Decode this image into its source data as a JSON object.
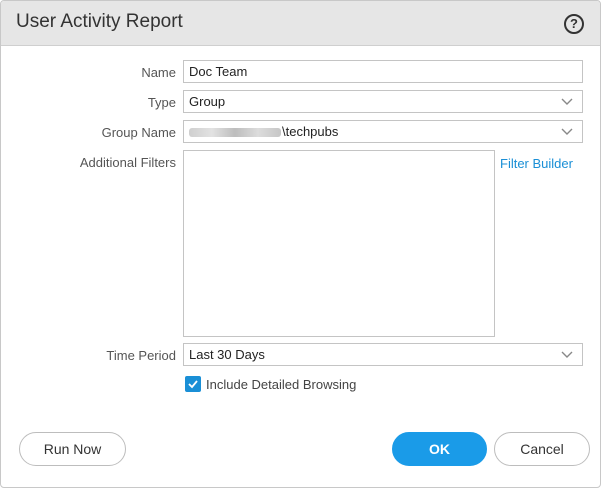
{
  "dialog": {
    "title": "User Activity Report",
    "help_icon": "help-circle-icon"
  },
  "form": {
    "name": {
      "label": "Name",
      "value": "Doc Team"
    },
    "type": {
      "label": "Type",
      "value": "Group"
    },
    "group_name": {
      "label": "Group Name",
      "value": "\\techpubs",
      "prefix_redacted": true
    },
    "additional_filters": {
      "label": "Additional Filters",
      "value": "",
      "link": "Filter Builder"
    },
    "time_period": {
      "label": "Time Period",
      "value": "Last 30 Days"
    },
    "include_detailed_browsing": {
      "label": "Include Detailed Browsing",
      "checked": true
    }
  },
  "buttons": {
    "run_now": "Run Now",
    "ok": "OK",
    "cancel": "Cancel"
  },
  "colors": {
    "accent": "#1a9be8",
    "link": "#1a8fd6",
    "titlebar": "#e6e6e6"
  }
}
